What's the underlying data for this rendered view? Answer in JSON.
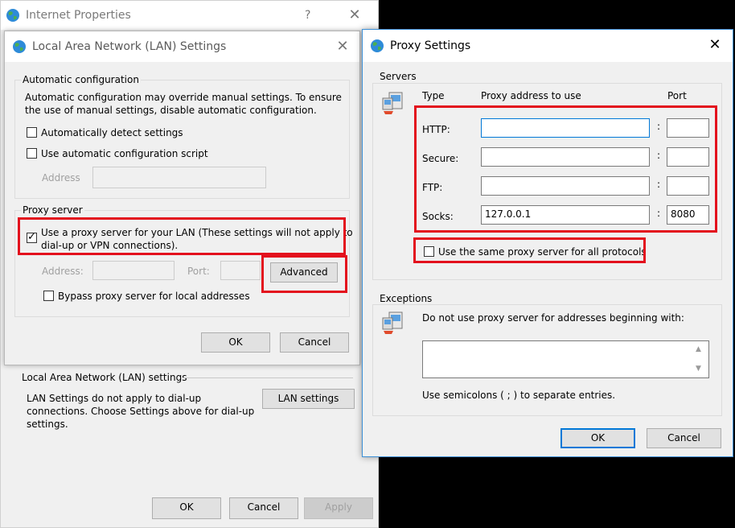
{
  "internet_properties": {
    "title": "Internet Properties",
    "help": "?",
    "close": "✕",
    "lan_group_label": "Local Area Network (LAN) settings",
    "lan_desc_1": "LAN Settings do not apply to dial-up",
    "lan_desc_2": "connections. Choose Settings above for dial-up",
    "lan_desc_3": "settings.",
    "lan_settings_button": "LAN settings",
    "ok": "OK",
    "cancel": "Cancel",
    "apply": "Apply"
  },
  "lan_dialog": {
    "title": "Local Area Network (LAN) Settings",
    "close": "✕",
    "auto_config_label": "Automatic configuration",
    "auto_desc_1": "Automatic configuration may override manual settings.  To ensure",
    "auto_desc_2": "the use of manual settings, disable automatic configuration.",
    "auto_detect_label": "Automatically detect settings",
    "auto_detect_checked": false,
    "auto_script_label": "Use automatic configuration script",
    "auto_script_checked": false,
    "address_label": "Address",
    "address_value": "",
    "proxy_group_label": "Proxy server",
    "use_proxy_label_1": "Use a proxy server for your LAN (These settings will not apply to",
    "use_proxy_label_2": "dial-up or VPN connections).",
    "use_proxy_checked": true,
    "proxy_address_label": "Address:",
    "proxy_address_value": "",
    "proxy_port_label": "Port:",
    "proxy_port_value": "",
    "advanced_button": "Advanced",
    "bypass_label": "Bypass proxy server for local addresses",
    "bypass_checked": false,
    "ok": "OK",
    "cancel": "Cancel"
  },
  "proxy_dialog": {
    "title": "Proxy Settings",
    "close": "✕",
    "servers_label": "Servers",
    "col_type": "Type",
    "col_address": "Proxy address to use",
    "col_port": "Port",
    "rows": [
      {
        "type": "HTTP:",
        "address": "",
        "port": ""
      },
      {
        "type": "Secure:",
        "address": "",
        "port": ""
      },
      {
        "type": "FTP:",
        "address": "",
        "port": ""
      },
      {
        "type": "Socks:",
        "address": "127.0.0.1",
        "port": "8080"
      }
    ],
    "colon": ":",
    "same_proxy_label": "Use the same proxy server for all protocols",
    "same_proxy_checked": false,
    "exceptions_label": "Exceptions",
    "exceptions_desc": "Do not use proxy server for addresses beginning with:",
    "exceptions_value": "",
    "exceptions_hint": "Use semicolons ( ; ) to separate entries.",
    "ok": "OK",
    "cancel": "Cancel"
  },
  "colors": {
    "highlight_red": "#e3101d",
    "focus_blue": "#0078d7",
    "dialog_bg": "#f0f0f0",
    "background": "#000000"
  },
  "icons": [
    "globe-icon",
    "network-computers-icon",
    "close-icon",
    "help-icon"
  ]
}
